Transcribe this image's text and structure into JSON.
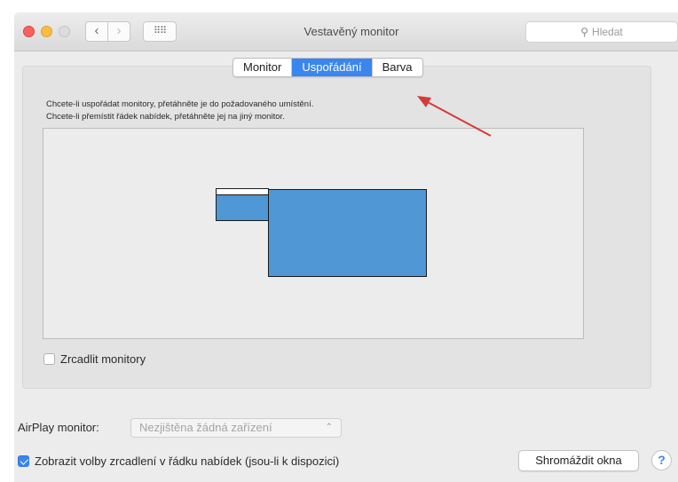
{
  "window": {
    "title": "Vestavěný monitor",
    "search_placeholder": "Hledat"
  },
  "tabs": [
    {
      "label": "Monitor",
      "active": false
    },
    {
      "label": "Uspořádání",
      "active": true
    },
    {
      "label": "Barva",
      "active": false
    }
  ],
  "instructions": {
    "line1": "Chcete-li uspořádat monitory, přetáhněte je do požadovaného umístění.",
    "line2": "Chcete-li přemístit řádek nabídek, přetáhněte jej na jiný monitor."
  },
  "mirror": {
    "label": "Zrcadlit monitory",
    "checked": false
  },
  "airplay": {
    "label": "AirPlay monitor:",
    "value": "Nezjištěna žádná zařízení"
  },
  "show_mirroring": {
    "label": "Zobrazit volby zrcadlení v řádku nabídek (jsou-li k dispozici)",
    "checked": true
  },
  "gather_button": "Shromáždit okna",
  "help_button": "?",
  "colors": {
    "accent": "#3a86ee",
    "monitor_fill": "#4f97d5",
    "annotation_arrow": "#d63a3a"
  },
  "icons": {
    "back": "chevron-left-icon",
    "forward": "chevron-right-icon",
    "grid": "grid-icon",
    "search": "magnifier-icon",
    "arrows": "up-down-arrows-icon"
  }
}
